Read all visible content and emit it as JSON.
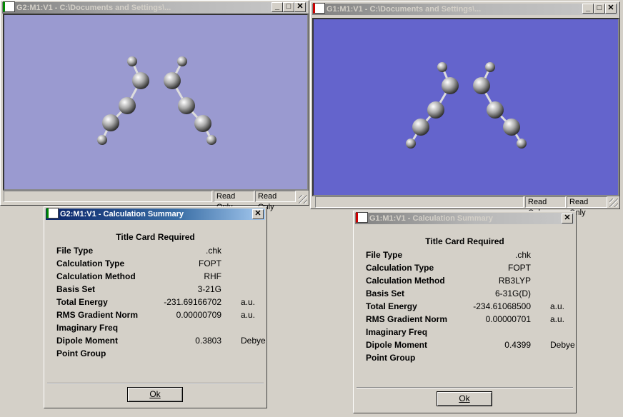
{
  "windows": [
    {
      "title": "G2:M1:V1 - C:\\Documents and Settings\\...",
      "status": [
        "",
        "Read Only",
        "Read Only"
      ],
      "bg": "#9a9ad0"
    },
    {
      "title": "G1:M1:V1 - C:\\Documents and Settings\\...",
      "status": [
        "",
        "Read Only",
        "Read Only"
      ],
      "bg": "#6464cc"
    }
  ],
  "dialogs": [
    {
      "title": "G2:M1:V1 - Calculation Summary",
      "heading": "Title Card Required",
      "ok": "Ok",
      "rows": [
        {
          "label": "File Type",
          "value": ".chk",
          "unit": ""
        },
        {
          "label": "Calculation Type",
          "value": "FOPT",
          "unit": ""
        },
        {
          "label": "Calculation Method",
          "value": "RHF",
          "unit": ""
        },
        {
          "label": "Basis Set",
          "value": "3-21G",
          "unit": ""
        },
        {
          "label": "Total Energy",
          "value": "-231.69166702",
          "unit": "a.u."
        },
        {
          "label": "RMS Gradient Norm",
          "value": "0.00000709",
          "unit": "a.u."
        },
        {
          "label": "Imaginary Freq",
          "value": "",
          "unit": ""
        },
        {
          "label": "Dipole Moment",
          "value": "0.3803",
          "unit": "Debye"
        },
        {
          "label": "Point Group",
          "value": "",
          "unit": ""
        }
      ]
    },
    {
      "title": "G1:M1:V1 - Calculation Summary",
      "heading": "Title Card Required",
      "ok": "Ok",
      "rows": [
        {
          "label": "File Type",
          "value": ".chk",
          "unit": ""
        },
        {
          "label": "Calculation Type",
          "value": "FOPT",
          "unit": ""
        },
        {
          "label": "Calculation Method",
          "value": "RB3LYP",
          "unit": ""
        },
        {
          "label": "Basis Set",
          "value": "6-31G(D)",
          "unit": ""
        },
        {
          "label": "Total Energy",
          "value": "-234.61068500",
          "unit": "a.u."
        },
        {
          "label": "RMS Gradient Norm",
          "value": "0.00000701",
          "unit": "a.u."
        },
        {
          "label": "Imaginary Freq",
          "value": "",
          "unit": ""
        },
        {
          "label": "Dipole Moment",
          "value": "0.4399",
          "unit": "Debye"
        },
        {
          "label": "Point Group",
          "value": "",
          "unit": ""
        }
      ]
    }
  ],
  "icons": {
    "minimize": "_",
    "maximize": "□",
    "close": "✕"
  }
}
